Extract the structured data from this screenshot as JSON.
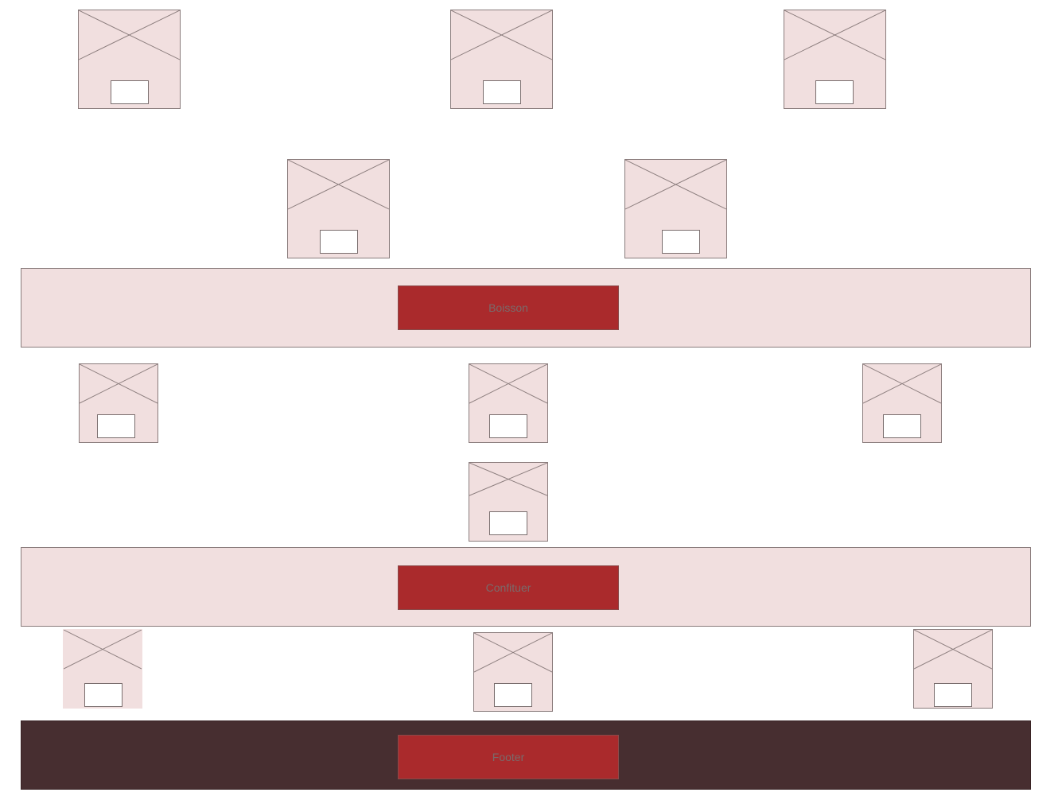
{
  "sections": {
    "boisson": {
      "label": "Boisson"
    },
    "confituer": {
      "label": "Confituer"
    },
    "footer": {
      "label": "Footer"
    }
  },
  "icons": {
    "image_placeholder": "image-placeholder-icon"
  },
  "colors": {
    "placeholder_bg": "#f1dfdf",
    "band_bg": "#f1dfdf",
    "button_bg": "#aa2a2c",
    "button_text": "#7a6a6a",
    "footer_bg": "#472e30",
    "border": "#8a7c7c"
  }
}
